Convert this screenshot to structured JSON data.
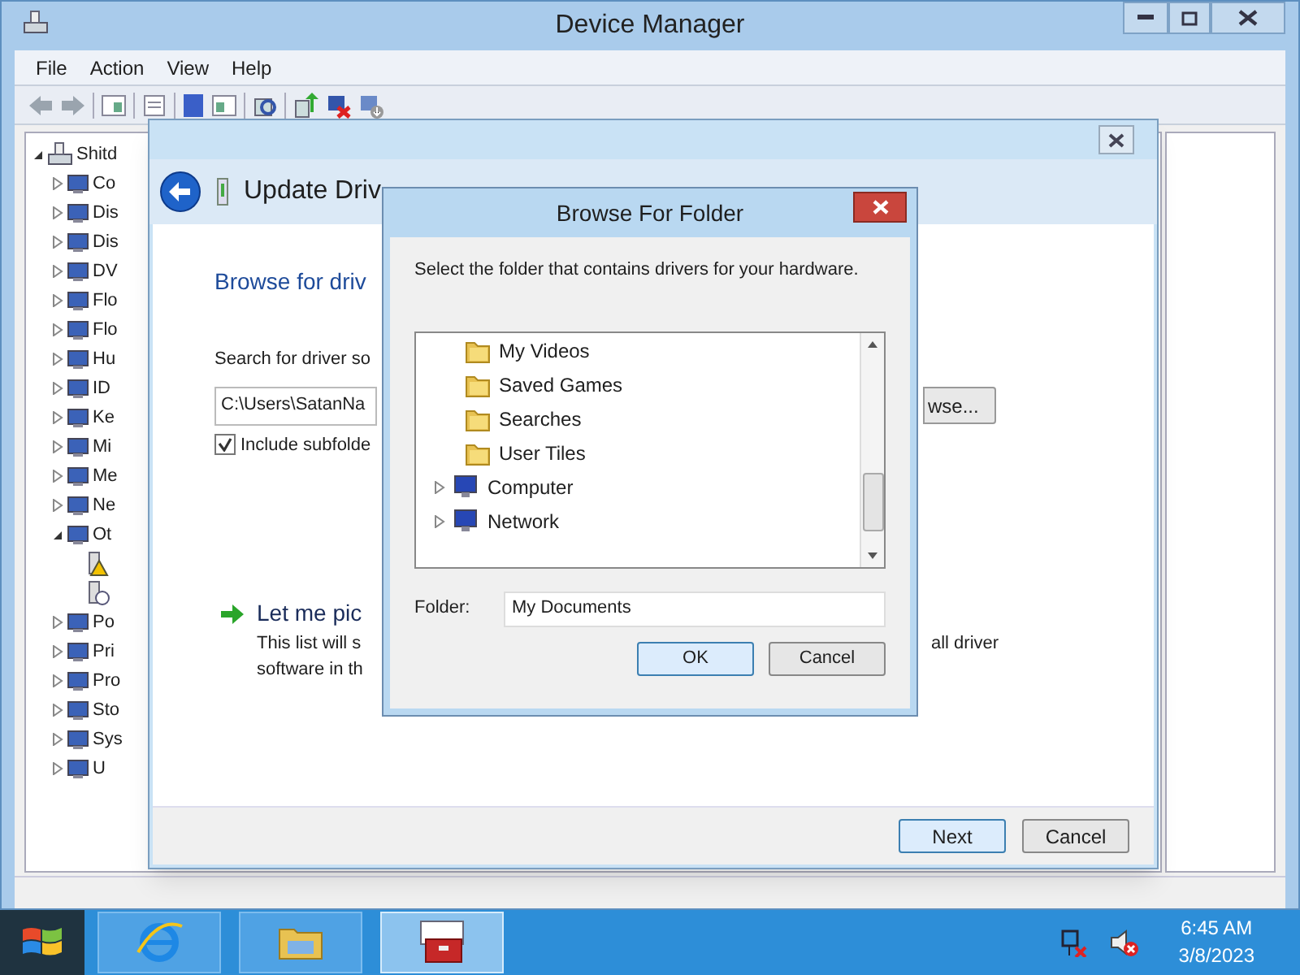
{
  "window": {
    "title": "Device Manager"
  },
  "menu": [
    "File",
    "Action",
    "View",
    "Help"
  ],
  "device_tree": {
    "label": "Shitd",
    "expanded": true,
    "children": [
      {
        "label": "Co",
        "expanded": false
      },
      {
        "label": "Dis",
        "expanded": false
      },
      {
        "label": "Dis",
        "expanded": false
      },
      {
        "label": "DV",
        "expanded": false
      },
      {
        "label": "Flo",
        "expanded": false
      },
      {
        "label": "Flo",
        "expanded": false
      },
      {
        "label": "Hu",
        "expanded": false
      },
      {
        "label": "ID",
        "expanded": false
      },
      {
        "label": "Ke",
        "expanded": false
      },
      {
        "label": "Mi",
        "expanded": false
      },
      {
        "label": "Me",
        "expanded": false
      },
      {
        "label": "Ne",
        "expanded": false
      },
      {
        "label": "Ot",
        "expanded": true,
        "children": [
          {
            "kind": "warning"
          },
          {
            "kind": "unknown"
          }
        ]
      },
      {
        "label": "Po",
        "expanded": false
      },
      {
        "label": "Pri",
        "expanded": false
      },
      {
        "label": "Pro",
        "expanded": false
      },
      {
        "label": "Sto",
        "expanded": false
      },
      {
        "label": "Sys",
        "expanded": false
      },
      {
        "label": "U",
        "expanded": false
      }
    ]
  },
  "update_driver_dialog": {
    "title": "Update Driv",
    "heading": "Browse for driv",
    "search_label": "Search for driver so",
    "path_value": "C:\\Users\\SatanNa",
    "include_subfolders": {
      "label": "Include subfolde",
      "checked": true
    },
    "browse_button": "wse...",
    "pick_link": "Let me pic",
    "pick_text_left": [
      "This list will s",
      "software in th"
    ],
    "pick_text_right": "all driver",
    "buttons": [
      {
        "label": "Next",
        "default": true
      },
      {
        "label": "Cancel",
        "default": false
      }
    ]
  },
  "browse_dialog": {
    "title": "Browse For Folder",
    "instruction": "Select the folder that contains drivers for your hardware.",
    "tree": [
      {
        "children": [
          {
            "label": "My Videos"
          },
          {
            "label": "Saved Games"
          },
          {
            "label": "Searches"
          },
          {
            "label": "User Tiles"
          }
        ]
      },
      {
        "label": "Computer",
        "expanded": false
      },
      {
        "label": "Network",
        "expanded": false
      }
    ],
    "folder_label": "Folder:",
    "folder_value": "My Documents",
    "buttons": [
      {
        "label": "OK",
        "default": true
      },
      {
        "label": "Cancel",
        "default": false
      }
    ]
  },
  "taskbar": {
    "apps": [
      {
        "kind": "browser",
        "active": false
      },
      {
        "kind": "files",
        "active": false
      },
      {
        "kind": "toolbox",
        "active": true
      }
    ],
    "time": "6:45 AM",
    "date": "3/8/2023"
  }
}
